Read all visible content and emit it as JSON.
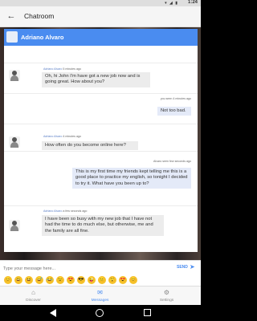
{
  "status_bar": {
    "time": "1:24",
    "icons": "▾ ◢ ▮"
  },
  "app_bar": {
    "back_icon": "arrow-left-icon",
    "title": "Chatroom"
  },
  "profile": {
    "name": "Adriano Alvaro"
  },
  "messages": [
    {
      "sender": "Adriano Alvaro",
      "time": "5 minutes ago",
      "text": "Oh, hi John I'm have got a new job now and is going great. How about you?",
      "direction": "received"
    },
    {
      "sender": "you",
      "status": "seen",
      "time": "4 minutes ago",
      "text": "Not too bad.",
      "direction": "sent"
    },
    {
      "sender": "Adriano Alvaro",
      "time": "4 minutes ago",
      "text": "How often do you become online here?",
      "direction": "received"
    },
    {
      "sender": "Alvaro",
      "status": "seen",
      "time": "few seconds ago",
      "text": "This is my first time my friends kept telling me this is a good place to practice my english, so tonight I decided to try it. What have you been up to?",
      "direction": "sent"
    },
    {
      "sender": "Adriano Alvaro",
      "time": "a few seconds ago",
      "text": "I have been so busy with my new job that I have not had the time to do much else, but otherwise, me and the family are all fine.",
      "direction": "received"
    }
  ],
  "composer": {
    "placeholder": "Type your message here...",
    "send_label": "SEND",
    "send_icon": "send-arrow-icon"
  },
  "emojis": [
    "😊",
    "😃",
    "😆",
    "😅",
    "😂",
    "😉",
    "😍",
    "😎",
    "😜",
    "😐",
    "😲",
    "😍",
    "😊"
  ],
  "tabs": [
    {
      "label": "Discover",
      "icon": "home-icon",
      "glyph": "⌂",
      "active": false
    },
    {
      "label": "Messages",
      "icon": "mail-icon",
      "glyph": "✉",
      "active": true
    },
    {
      "label": "Settings",
      "icon": "gear-icon",
      "glyph": "⚙",
      "active": false
    }
  ],
  "colors": {
    "accent": "#4a8cf0",
    "bubble_received": "#ececec",
    "bubble_sent": "#e4eaf8"
  }
}
